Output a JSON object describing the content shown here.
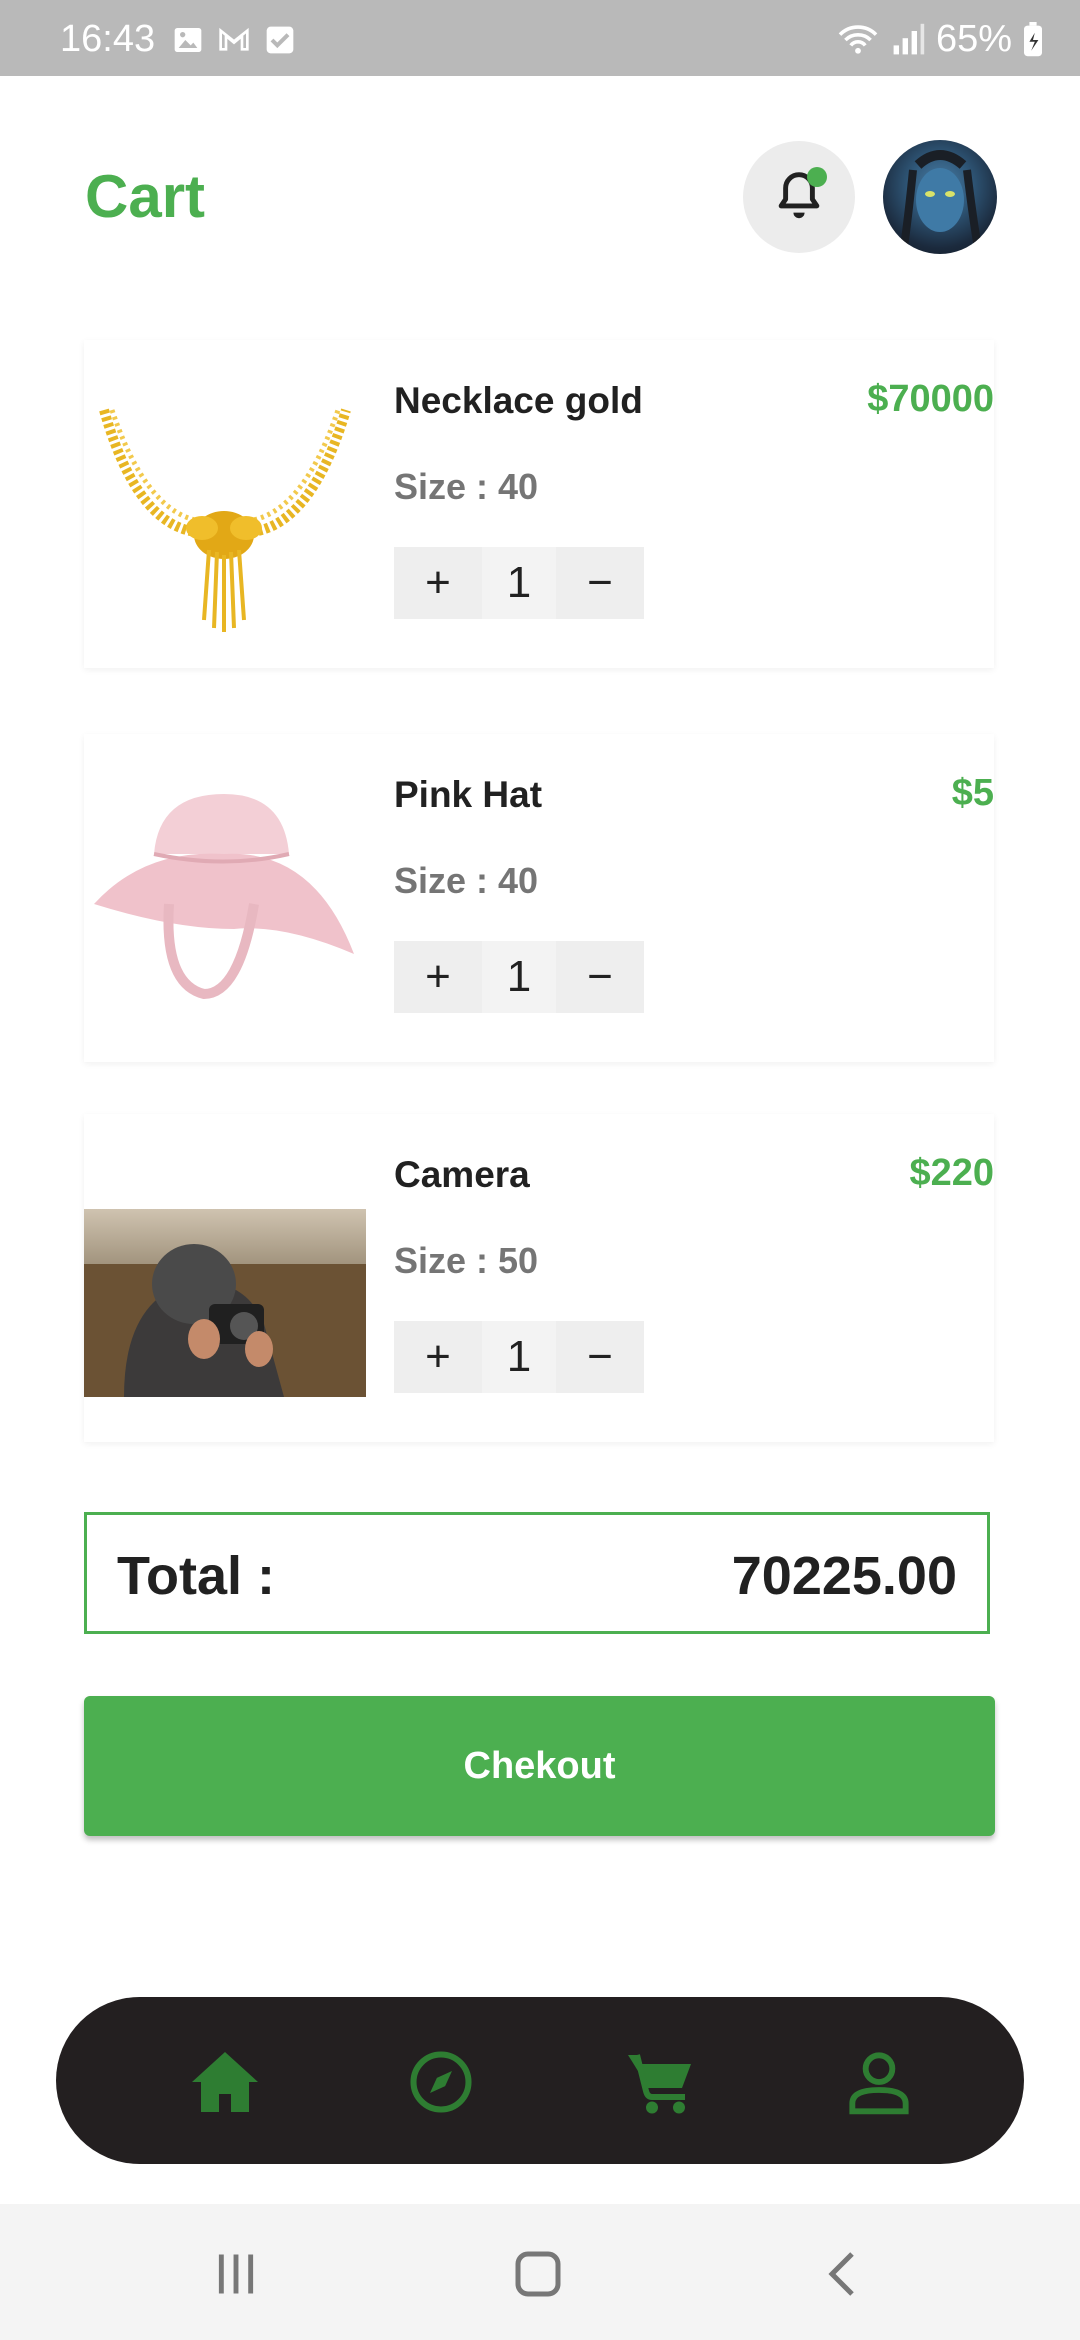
{
  "status_bar": {
    "time": "16:43",
    "battery": "65%",
    "icons": [
      "image-icon",
      "gmail-icon",
      "check-icon",
      "wifi-icon",
      "signal-icon",
      "battery-icon"
    ]
  },
  "header": {
    "title": "Cart",
    "icons": [
      "bell-icon",
      "avatar"
    ]
  },
  "cart": {
    "items": [
      {
        "name": "Necklace gold",
        "price": "$70000",
        "size": "Size : 40",
        "qty": "1",
        "plus": "+",
        "minus": "−"
      },
      {
        "name": "Pink Hat",
        "price": "$5",
        "size": "Size : 40",
        "qty": "1",
        "plus": "+",
        "minus": "−"
      },
      {
        "name": "Camera",
        "price": "$220",
        "size": "Size : 50",
        "qty": "1",
        "plus": "+",
        "minus": "−"
      }
    ]
  },
  "total": {
    "label": "Total :",
    "value": "70225.00"
  },
  "checkout": {
    "label": "Chekout"
  },
  "bottom_nav": {
    "items": [
      "home-icon",
      "explore-icon",
      "cart-icon",
      "profile-icon"
    ]
  },
  "colors": {
    "accent": "#4caf50",
    "nav_bg": "#231f20",
    "nav_icon": "#2e7d32"
  }
}
